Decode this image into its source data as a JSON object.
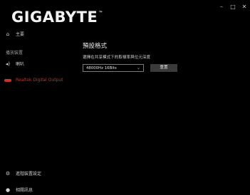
{
  "window": {
    "minimize": "–",
    "maximize": "□",
    "close": "✕"
  },
  "app": {
    "logo": "GIGABYTE",
    "trademark": "™"
  },
  "sidebar": {
    "home": {
      "label": "主要",
      "icon": "home-icon"
    },
    "section_label": "播放裝置",
    "speaker": {
      "label": "喇叭",
      "icon": "speaker-icon"
    },
    "active_device": {
      "label": "Realtek Digital Output",
      "color": "#c8342b"
    },
    "advanced": {
      "label": "進階裝置設定",
      "icon": "gear-icon"
    },
    "about": {
      "label": "相關訊息",
      "icon": "info-icon"
    }
  },
  "main": {
    "title": "預設格式",
    "description": "選擇在共享模式下的取樣率與位元深度",
    "format_select": {
      "value": "48000Hz 16Bits"
    },
    "reset_button": "重置"
  }
}
